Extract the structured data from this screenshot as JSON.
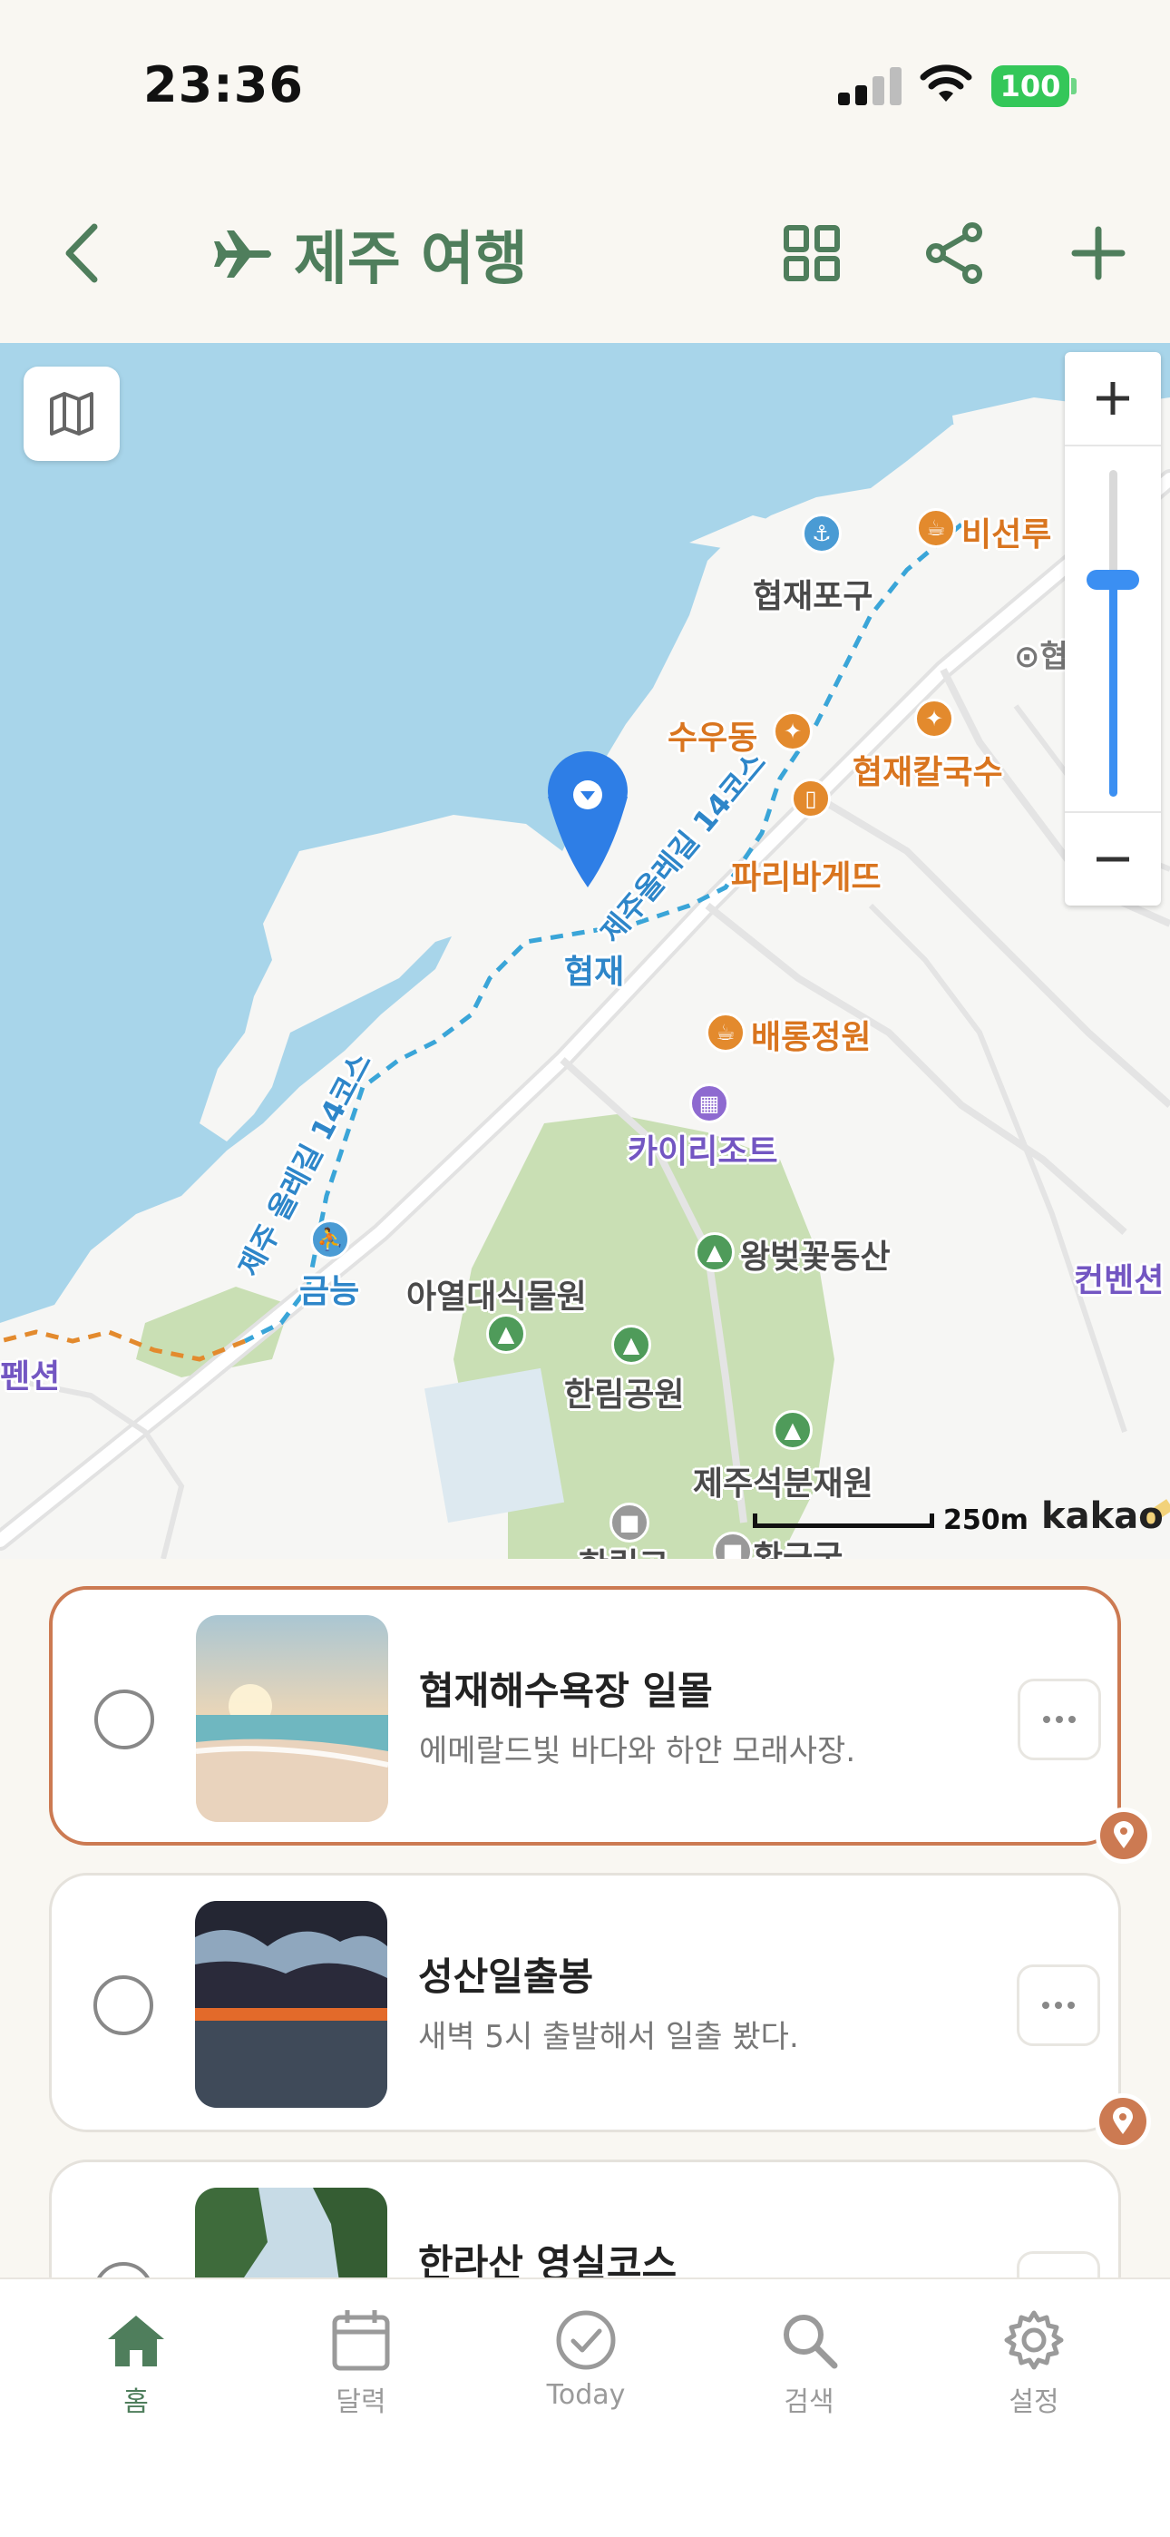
{
  "status_bar": {
    "time": "23:36",
    "battery": "100"
  },
  "header": {
    "title": "제주 여행"
  },
  "map": {
    "labels": {
      "hyeopjae_port": "협재포구",
      "bisunru": "비선루",
      "hyeopjae_right": "⊙협재리사",
      "suudong": "수우동",
      "kalguksu": "협재칼국수",
      "paris": "파리바게뜨",
      "hyeopjae": "협재",
      "baerong": "배롱정원",
      "kairi": "카이리조트",
      "cherry": "왕벚꽃동산",
      "convention": "컨벤션",
      "geumneung": "금능",
      "tropical": "아열대식물원",
      "hallim": "한림공원",
      "stonepark": "제주석분재원",
      "olle_left": "제주 올레길 14코스",
      "olle_right": "제주올레길 14코스",
      "pension": "펜션",
      "bottom_a": "한림고",
      "bottom_b": "환금궁"
    },
    "scale": "250m",
    "provider": "kakao"
  },
  "places": [
    {
      "title": "협재해수욕장 일몰",
      "subtitle": "에메랄드빛 바다와 하얀 모래사장.",
      "selected": true
    },
    {
      "title": "성산일출봉",
      "subtitle": "새벽 5시 출발해서 일출 봤다.",
      "selected": false
    },
    {
      "title": "한라산 영실코스",
      "subtitle": "",
      "selected": false
    }
  ],
  "tabs": [
    {
      "label": "홈",
      "icon": "home-icon",
      "active": true
    },
    {
      "label": "달력",
      "icon": "calendar-icon",
      "active": false
    },
    {
      "label": "Today",
      "icon": "check-circle-icon",
      "active": false
    },
    {
      "label": "검색",
      "icon": "search-icon",
      "active": false
    },
    {
      "label": "설정",
      "icon": "gear-icon",
      "active": false
    }
  ],
  "colors": {
    "accent": "#4f7e5c",
    "selected_border": "#cc7a52",
    "sea": "#a8d5ea",
    "park": "#c9dfb4"
  }
}
